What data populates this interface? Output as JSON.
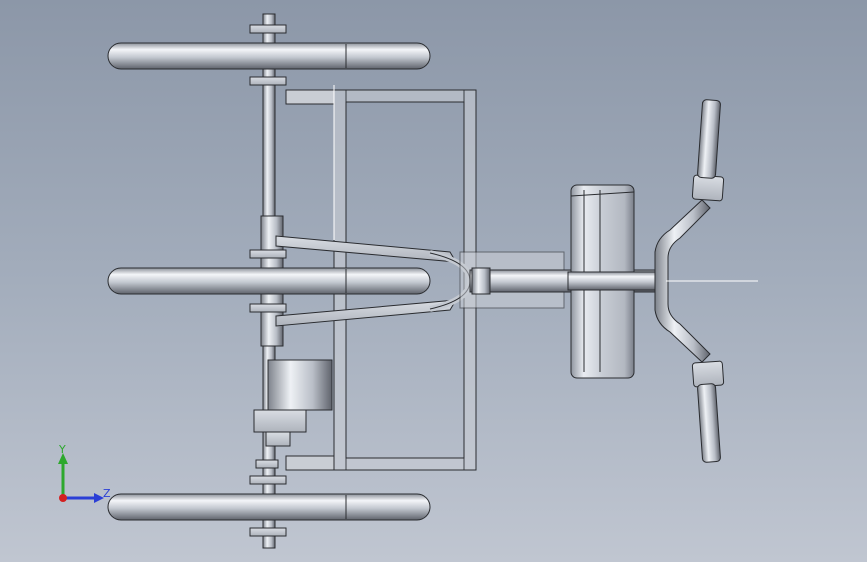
{
  "viewport": {
    "background_top": "#8c97a8",
    "background_bottom": "#c0c6d1",
    "model": "tricycle-frame-assembly",
    "view": "top"
  },
  "triad": {
    "y_label": "Y",
    "z_label": "Z",
    "y_color": "#2da82d",
    "z_color": "#2b3fd6",
    "x_color": "#d32020"
  },
  "colors": {
    "metal_light": "#e8ebf0",
    "metal_mid": "#b9bec7",
    "metal_dark": "#6f7480",
    "edge": "#2a2c30"
  }
}
